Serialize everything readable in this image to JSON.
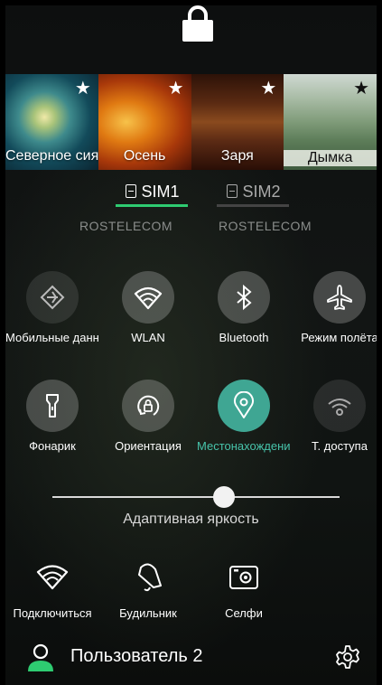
{
  "themes": [
    {
      "label": "Северное сияние",
      "favorite": true
    },
    {
      "label": "Осень",
      "favorite": true
    },
    {
      "label": "Заря",
      "favorite": true
    },
    {
      "label": "Дымка",
      "favorite": true
    }
  ],
  "sim": {
    "tabs": [
      {
        "label": "SIM1",
        "operator": "ROSTELECOM",
        "selected": true
      },
      {
        "label": "SIM2",
        "operator": "ROSTELECOM",
        "selected": false
      }
    ]
  },
  "toggles": {
    "mobile_data": "Мобильные данные",
    "wlan": "WLAN",
    "bluetooth": "Bluetooth",
    "airplane": "Режим полёта",
    "flashlight": "Фонарик",
    "orientation": "Ориентация",
    "location": "Местонахождение",
    "hotspot": "Т. доступа"
  },
  "brightness": {
    "label": "Адаптивная яркость",
    "level": 0.6
  },
  "shortcuts": {
    "connect": "Подключиться",
    "alarm": "Будильник",
    "selfie": "Селфи"
  },
  "user": {
    "name": "Пользователь 2"
  },
  "colors": {
    "accent": "#3fa693",
    "sim_selected": "#2ecc71"
  }
}
